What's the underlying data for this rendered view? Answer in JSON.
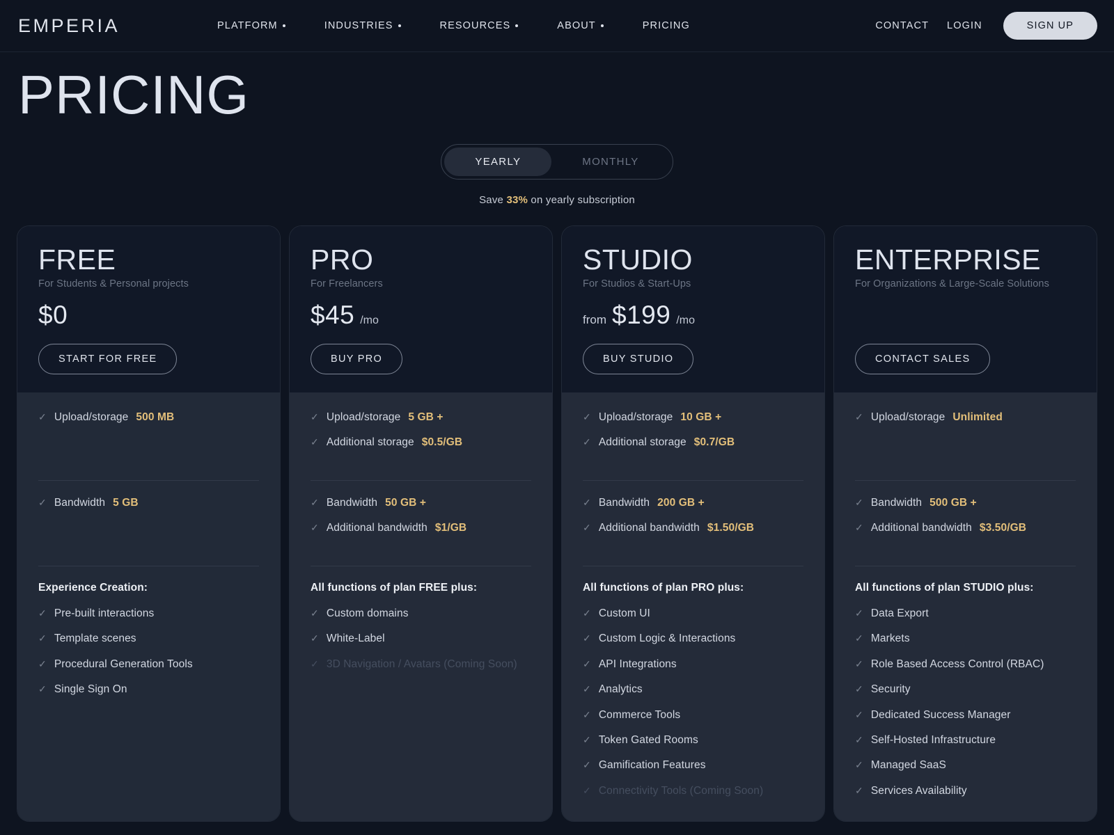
{
  "nav": {
    "logo": "EMPERIA",
    "links": [
      {
        "label": "PLATFORM",
        "has_dropdown": true
      },
      {
        "label": "INDUSTRIES",
        "has_dropdown": true
      },
      {
        "label": "RESOURCES",
        "has_dropdown": true
      },
      {
        "label": "ABOUT",
        "has_dropdown": true
      },
      {
        "label": "PRICING",
        "has_dropdown": false
      }
    ],
    "contact": "CONTACT",
    "login": "LOGIN",
    "signup": "SIGN UP"
  },
  "hero": {
    "title": "PRICING"
  },
  "billing": {
    "yearly": "YEARLY",
    "monthly": "MONTHLY",
    "selected": "YEARLY",
    "save_prefix": "Save ",
    "save_percent": "33%",
    "save_suffix": " on yearly subscription"
  },
  "colors": {
    "page_bg": "#0e1420",
    "card_head_bg": "#111827",
    "card_body_bg": "#242b39",
    "accent_gold": "#e3bf7a",
    "text_primary": "#dfe4ee",
    "text_muted": "#6c7585"
  },
  "plans": [
    {
      "name": "FREE",
      "subtitle": "For Students & Personal projects",
      "price_from": "",
      "price": "$0",
      "price_period": "",
      "cta": "START FOR FREE",
      "storage": [
        {
          "text": "Upload/storage ",
          "value": "500 MB",
          "dim": false
        }
      ],
      "bandwidth": [
        {
          "text": "Bandwidth ",
          "value": "5 GB",
          "dim": false
        }
      ],
      "section_head": "Experience Creation:",
      "features": [
        {
          "text": "Pre-built interactions",
          "dim": false
        },
        {
          "text": "Template scenes",
          "dim": false
        },
        {
          "text": "Procedural Generation Tools",
          "dim": false
        },
        {
          "text": "Single Sign On",
          "dim": false
        }
      ]
    },
    {
      "name": "PRO",
      "subtitle": "For Freelancers",
      "price_from": "",
      "price": "$45",
      "price_period": "/mo",
      "cta": "BUY PRO",
      "storage": [
        {
          "text": "Upload/storage ",
          "value": "5 GB +",
          "dim": false
        },
        {
          "text": "Additional storage ",
          "value": "$0.5/GB",
          "dim": false
        }
      ],
      "bandwidth": [
        {
          "text": "Bandwidth ",
          "value": "50 GB +",
          "dim": false
        },
        {
          "text": "Additional bandwidth ",
          "value": "$1/GB",
          "dim": false
        }
      ],
      "section_head": "All functions of plan FREE plus:",
      "features": [
        {
          "text": "Custom domains",
          "dim": false
        },
        {
          "text": "White-Label",
          "dim": false
        },
        {
          "text": "3D Navigation / Avatars (Coming Soon)",
          "dim": true
        }
      ]
    },
    {
      "name": "STUDIO",
      "subtitle": "For Studios & Start-Ups",
      "price_from": "from",
      "price": "$199",
      "price_period": "/mo",
      "cta": "BUY STUDIO",
      "storage": [
        {
          "text": "Upload/storage ",
          "value": "10 GB +",
          "dim": false
        },
        {
          "text": "Additional storage ",
          "value": "$0.7/GB",
          "dim": false
        }
      ],
      "bandwidth": [
        {
          "text": "Bandwidth ",
          "value": "200 GB +",
          "dim": false
        },
        {
          "text": "Additional bandwidth ",
          "value": "$1.50/GB",
          "dim": false
        }
      ],
      "section_head": "All functions of plan PRO plus:",
      "features": [
        {
          "text": "Custom UI",
          "dim": false
        },
        {
          "text": "Custom Logic & Interactions",
          "dim": false
        },
        {
          "text": "API Integrations",
          "dim": false
        },
        {
          "text": "Analytics",
          "dim": false
        },
        {
          "text": "Commerce Tools",
          "dim": false
        },
        {
          "text": "Token Gated Rooms",
          "dim": false
        },
        {
          "text": "Gamification Features",
          "dim": false
        },
        {
          "text": "Connectivity Tools (Coming Soon)",
          "dim": true
        }
      ]
    },
    {
      "name": "ENTERPRISE",
      "subtitle": "For Organizations & Large-Scale Solutions",
      "price_from": "",
      "price": "",
      "price_period": "",
      "cta": "CONTACT SALES",
      "storage": [
        {
          "text": "Upload/storage ",
          "value": "Unlimited",
          "dim": false
        }
      ],
      "bandwidth": [
        {
          "text": "Bandwidth ",
          "value": "500 GB +",
          "dim": false
        },
        {
          "text": "Additional bandwidth ",
          "value": "$3.50/GB",
          "dim": false
        }
      ],
      "section_head": "All functions of plan STUDIO plus:",
      "features": [
        {
          "text": "Data Export",
          "dim": false
        },
        {
          "text": "Markets",
          "dim": false
        },
        {
          "text": "Role Based Access Control (RBAC)",
          "dim": false
        },
        {
          "text": "Security",
          "dim": false
        },
        {
          "text": "Dedicated Success Manager",
          "dim": false
        },
        {
          "text": "Self-Hosted Infrastructure",
          "dim": false
        },
        {
          "text": "Managed SaaS",
          "dim": false
        },
        {
          "text": "Services Availability",
          "dim": false
        }
      ]
    }
  ]
}
